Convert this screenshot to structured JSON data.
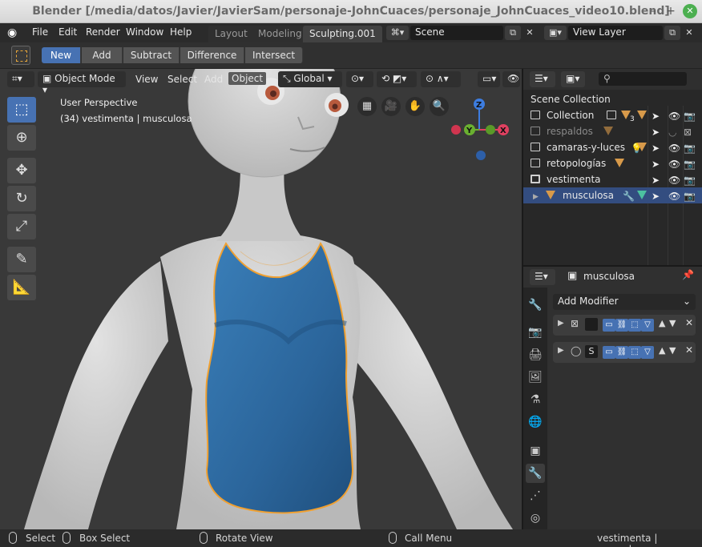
{
  "window": {
    "title": "Blender [/media/datos/Javier/JavierSam/personaje-JohnCuaces/personaje_JohnCuaces_video10.blend]"
  },
  "topbar": {
    "menus": [
      "File",
      "Edit",
      "Render",
      "Window",
      "Help"
    ],
    "workspaces": [
      {
        "label": "Layout",
        "active": false
      },
      {
        "label": "Modeling",
        "active": false
      },
      {
        "label": "Sculpting.001",
        "active": true
      }
    ],
    "scene": "Scene",
    "view_layer": "View Layer"
  },
  "tool_settings": {
    "modes": [
      {
        "label": "New",
        "selected": true
      },
      {
        "label": "Add",
        "selected": false
      },
      {
        "label": "Subtract",
        "selected": false
      },
      {
        "label": "Difference",
        "selected": false
      },
      {
        "label": "Intersect",
        "selected": false
      }
    ]
  },
  "viewport": {
    "mode": "Object Mode",
    "menus": [
      "View",
      "Select",
      "Add",
      "Object"
    ],
    "orientation": "Global",
    "perspective_label": "User Perspective",
    "object_info": "(34) vestimenta | musculosa",
    "gizmo": {
      "z": "Z",
      "y": "Y",
      "x": "X"
    }
  },
  "outliner": {
    "root": "Scene Collection",
    "items": [
      {
        "label": "Collection",
        "dim": false,
        "selected": false
      },
      {
        "label": "respaldos",
        "dim": true,
        "selected": false
      },
      {
        "label": "camaras-y-luces",
        "dim": false,
        "selected": false
      },
      {
        "label": "retopologías",
        "dim": false,
        "selected": false
      },
      {
        "label": "vestimenta",
        "dim": false,
        "selected": false
      },
      {
        "label": "musculosa",
        "dim": false,
        "selected": true
      }
    ],
    "collection_count": "3"
  },
  "properties": {
    "object_name": "musculosa",
    "add_modifier": "Add Modifier",
    "modifiers": [
      {
        "label": ""
      },
      {
        "label": "S"
      }
    ]
  },
  "statusbar": {
    "select": "Select",
    "box_select": "Box Select",
    "rotate_view": "Rotate View",
    "call_menu": "Call Menu",
    "info": "vestimenta | musculosa"
  },
  "colors": {
    "accent": "#4772b3",
    "shirt": "#2f6ea6",
    "skin": "#d3d3d3",
    "outline": "#f0a030"
  }
}
